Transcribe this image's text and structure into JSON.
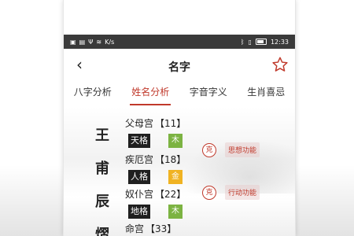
{
  "status_bar": {
    "time": "12:33",
    "net_speed": "K/s"
  },
  "header": {
    "title": "名字"
  },
  "tabs": [
    {
      "label": "八字分析"
    },
    {
      "label": "姓名分析",
      "active": true
    },
    {
      "label": "字音字义"
    },
    {
      "label": "生肖喜忌"
    }
  ],
  "name_chars": [
    "王",
    "甫",
    "辰",
    "熠"
  ],
  "palaces": [
    {
      "name": "父母宫",
      "number": "【11】"
    },
    {
      "name": "疾厄宫",
      "number": "【18】"
    },
    {
      "name": "奴仆宫",
      "number": "【22】"
    },
    {
      "name": "命宫",
      "number": "【33】"
    }
  ],
  "grids": [
    {
      "label": "天格",
      "element": "木"
    },
    {
      "label": "人格",
      "element": "金"
    },
    {
      "label": "地格",
      "element": "木"
    }
  ],
  "relations": [
    {
      "symbol": "克",
      "function": "思想功能"
    },
    {
      "symbol": "克",
      "function": "行动功能"
    }
  ],
  "colors": {
    "accent": "#c0392b",
    "wood": "#7cb342",
    "metal": "#f0b323"
  }
}
